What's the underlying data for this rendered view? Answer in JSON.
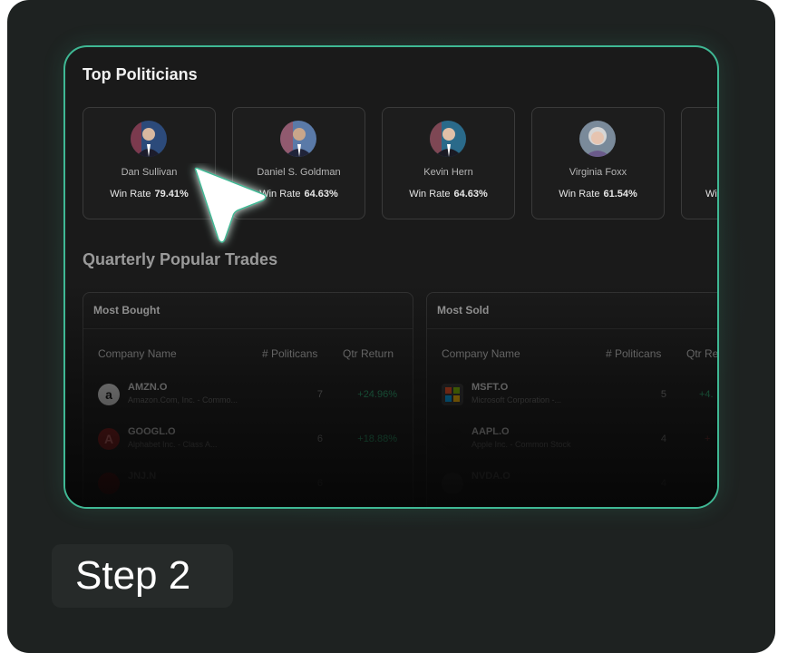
{
  "step_label": "Step 2",
  "sections": {
    "top_politicians": "Top Politicians",
    "quarterly_trades": "Quarterly Popular Trades"
  },
  "politicians": [
    {
      "name": "Dan Sullivan",
      "win_rate_label": "Win Rate",
      "win_rate": "79.41%"
    },
    {
      "name": "Daniel S. Goldman",
      "win_rate_label": "Win Rate",
      "win_rate": "64.63%"
    },
    {
      "name": "Kevin Hern",
      "win_rate_label": "Win Rate",
      "win_rate": "64.63%"
    },
    {
      "name": "Virginia Foxx",
      "win_rate_label": "Win Rate",
      "win_rate": "61.54%"
    },
    {
      "name": "",
      "win_rate_label": "Wi",
      "win_rate": ""
    }
  ],
  "most_bought": {
    "title": "Most Bought",
    "columns": [
      "Company Name",
      "# Politicans",
      "Qtr Return"
    ],
    "rows": [
      {
        "ticker": "AMZN.O",
        "company": "Amazon.Com, Inc. - Commo...",
        "count": "7",
        "return": "+24.96%",
        "logo": "amazon-logo-icon"
      },
      {
        "ticker": "GOOGL.O",
        "company": "Alphabet Inc. - Class A...",
        "count": "6",
        "return": "+18.88%",
        "logo": "alphabet-logo-icon"
      },
      {
        "ticker": "JNJ.N",
        "company": "",
        "count": "6",
        "return": "",
        "logo": "jnj-logo-icon"
      }
    ]
  },
  "most_sold": {
    "title": "Most Sold",
    "columns": [
      "Company Name",
      "# Politicans",
      "Qtr Re"
    ],
    "rows": [
      {
        "ticker": "MSFT.O",
        "company": "Microsoft Corporation -...",
        "count": "5",
        "return": "+4.",
        "logo": "microsoft-logo-icon"
      },
      {
        "ticker": "AAPL.O",
        "company": "Apple Inc. - Common Stock",
        "count": "4",
        "return": "+",
        "logo": "apple-logo-icon"
      },
      {
        "ticker": "NVDA.O",
        "company": "",
        "count": "4",
        "return": "",
        "logo": "nvidia-logo-icon"
      }
    ]
  },
  "colors": {
    "accent": "#3fb894",
    "return_positive": "#2aa56f",
    "background": "#1e2221"
  }
}
